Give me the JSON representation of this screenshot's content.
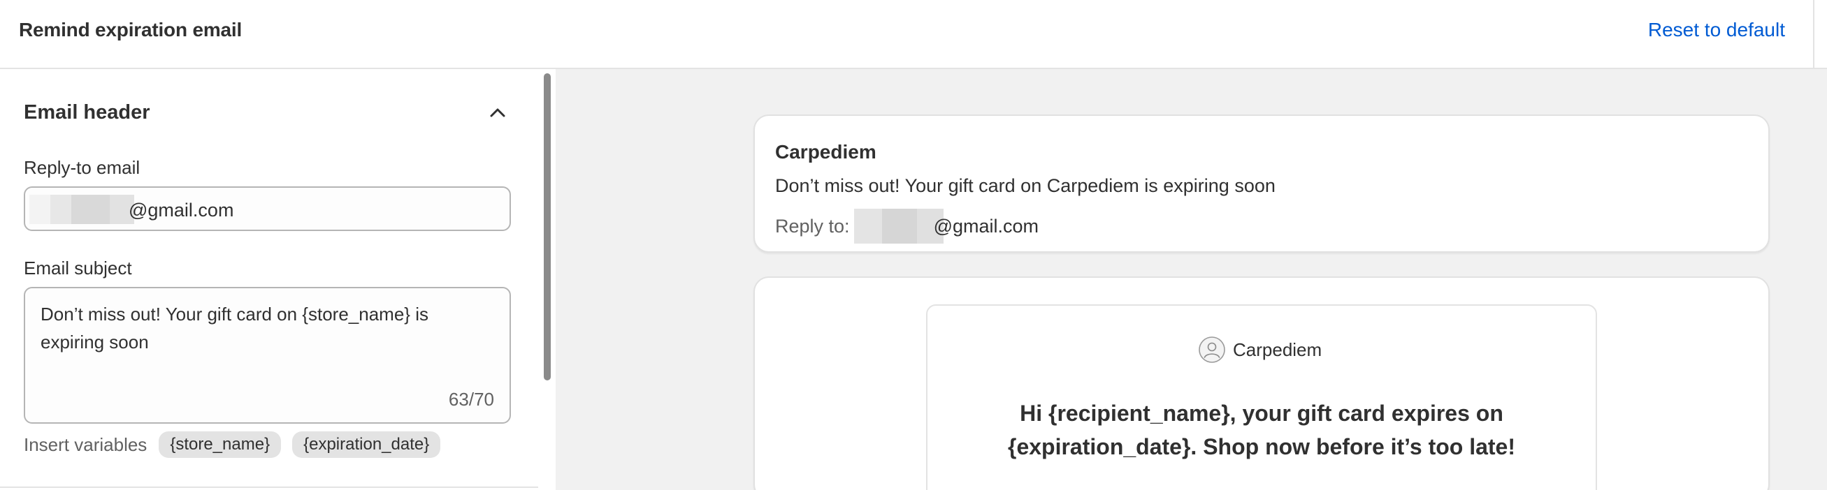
{
  "topbar": {
    "title": "Remind expiration email",
    "reset_label": "Reset to default"
  },
  "editor": {
    "section_title": "Email header",
    "collapse_icon": "chevron-up-icon",
    "reply_to": {
      "label": "Reply-to email",
      "value_visible": "@gmail.com"
    },
    "subject": {
      "label": "Email subject",
      "value": "Don’t miss out! Your gift card on {store_name} is expiring soon",
      "char_count": "63/70"
    },
    "insert_variables": {
      "label": "Insert variables",
      "chips": [
        "{store_name}",
        "{expiration_date}"
      ]
    }
  },
  "preview": {
    "header": {
      "sender": "Carpediem",
      "subject": "Don’t miss out! Your gift card on Carpediem is expiring soon",
      "reply_to_label": "Reply to:",
      "reply_to_value": "@gmail.com"
    },
    "body": {
      "brand_icon": "user-circle-icon",
      "brand_name": "Carpediem",
      "headline": "Hi {recipient_name}, your gift card expires on {expiration_date}. Shop now before it’s too late!"
    }
  },
  "colors": {
    "accent_link": "#005bd3",
    "text_primary": "#303030",
    "text_secondary": "#616161",
    "preview_bg": "#f1f1f1",
    "chip_bg": "#e3e3e3"
  }
}
